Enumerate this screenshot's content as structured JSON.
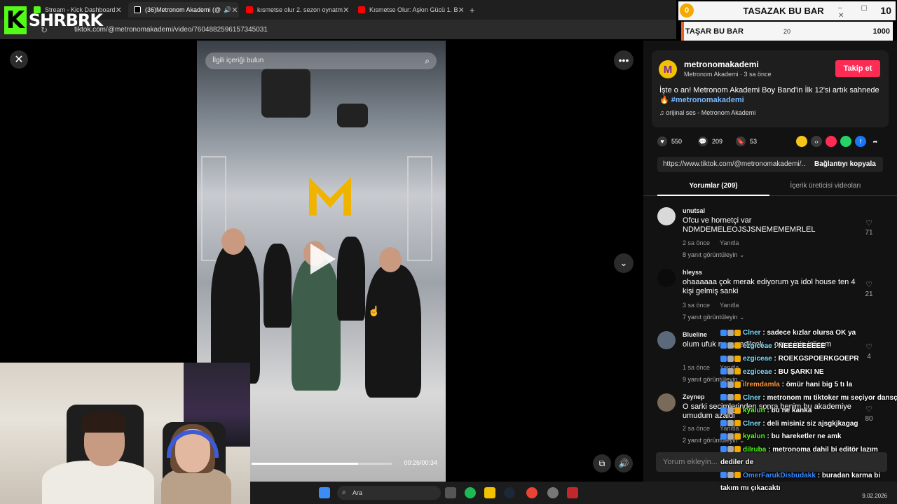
{
  "browser": {
    "tabs": [
      {
        "label": "Stream - Kick Dashboard",
        "active": false
      },
      {
        "label": "(36)Metronom Akademi (@",
        "active": true
      },
      {
        "label": "kısmetse olur 2. sezon oynatm",
        "active": false
      },
      {
        "label": "Kısmetse Olur: Aşkın Gücü 1. B",
        "active": false
      }
    ],
    "new_tab_label": "+",
    "url": "tiktok.com/@metronomakademi/video/7604882596157345031"
  },
  "stream_logo": {
    "k": "K",
    "text": "SHRBRK"
  },
  "scoreboard": {
    "badge": "0",
    "title": "TASAZAK BU BAR",
    "value": "10",
    "row_label": "TAŞAR BU BAR",
    "row_mid": "20",
    "row_value": "1000",
    "window_controls": "– ▢ ✕"
  },
  "video": {
    "search_placeholder": "İlgili içeriği bulun",
    "time": "00:26/00:34",
    "progress": 0.76
  },
  "creator": {
    "avatar_letter": "M",
    "name": "metronomakademi",
    "subtitle": "Metronom Akademi · 3 sa önce",
    "follow_label": "Takip et",
    "description": "İşte o an! Metronom Akademi Boy Band'in İlk 12'si artık sahnede 🔥",
    "hashtag": "#metronomakademi",
    "sound": "♫  orijinal ses - Metronom Akademi"
  },
  "stats": {
    "likes": "550",
    "comments": "209",
    "saves": "53"
  },
  "share_colors": [
    "#f5c518",
    "#3a3a3a",
    "#fe2c55",
    "#25d366",
    "#1877f2"
  ],
  "link": {
    "url": "https://www.tiktok.com/@metronomakademi/...",
    "copy_label": "Bağlantıyı kopyala"
  },
  "tabs": {
    "comments": "Yorumlar (209)",
    "creator_videos": "İçerik üreticisi videoları"
  },
  "comments": [
    {
      "user": "unutsal",
      "text": "Ofcu ve hornetçi var NDMDEMELEOJSJSNEMEMEMRLEL",
      "time": "2 sa önce",
      "reply": "Yanıtla",
      "replies": "8 yanıt görüntüleyin ⌄",
      "likes": "71"
    },
    {
      "user": "hleyss",
      "text": "ohaaaaaa çok merak ediyorum ya idol house ten 4 kişi gelmiş sanki",
      "time": "3 sa önce",
      "reply": "Yanıtla",
      "replies": "7 yanıt görüntüleyin ⌄",
      "likes": "21"
    },
    {
      "user": "Blueline",
      "text": "olum ufuk n... ... edilcek ... omur icin izlicem",
      "time": "1 sa önce",
      "reply": "Yanıtla",
      "replies": "9 yanıt görüntüleyin ⌄",
      "likes": "4"
    },
    {
      "user": "Zeynep",
      "text": "O sarki secimlerinden sonra benim bu akademiye umudum azaldi",
      "time": "2 sa önce",
      "reply": "Yanıtla",
      "replies": "2 yanıt görüntüleyin ⌄",
      "likes": "80"
    }
  ],
  "comment_input_placeholder": "Yorum ekleyin...",
  "taskbar": {
    "search_label": "Ara",
    "date": "9.02.2026"
  },
  "chat": [
    {
      "user": "Clner",
      "color": "#7ce0ff",
      "msg": "sadece kızlar olursa OK ya"
    },
    {
      "user": "ezgiceae",
      "color": "#7ce0ff",
      "msg": "NEEEEEEEEE"
    },
    {
      "user": "ezgiceae",
      "color": "#7ce0ff",
      "msg": "ROEKGSPOERKGOEPR"
    },
    {
      "user": "ezgiceae",
      "color": "#7ce0ff",
      "msg": "BU ŞARKI NE"
    },
    {
      "user": "ilremdamla",
      "color": "#ff9a3d",
      "msg": "ömür hani big 5 tı la"
    },
    {
      "user": "Clner",
      "color": "#7ce0ff",
      "msg": "metronom mı tiktoker mı seçiyor dansçı mı"
    },
    {
      "user": "kyalun",
      "color": "#53fc18",
      "msg": "bu ne kanka"
    },
    {
      "user": "Clner",
      "color": "#7ce0ff",
      "msg": "deli misiniz siz ajsgkjkagag"
    },
    {
      "user": "kyalun",
      "color": "#53fc18",
      "msg": "bu hareketler ne amk"
    },
    {
      "user": "dilruba",
      "color": "#53fc18",
      "msg": "metronoma dahil bi editör lazım"
    },
    {
      "user": "",
      "color": "#ffffff",
      "msg": "dediler de"
    },
    {
      "user": "OmerFarukDisbudakk",
      "color": "#3d8bff",
      "msg": "buradan karma bi"
    },
    {
      "user": "",
      "color": "#ffffff",
      "msg": "takım mı çıkacaktı"
    }
  ],
  "icons": {
    "close": "✕",
    "more": "•••",
    "down": "⌄",
    "volume": "🔊",
    "pip": "⧉",
    "search": "⌕",
    "heart": "♥",
    "comment": "💬",
    "bookmark": "🔖",
    "share": "➦"
  }
}
